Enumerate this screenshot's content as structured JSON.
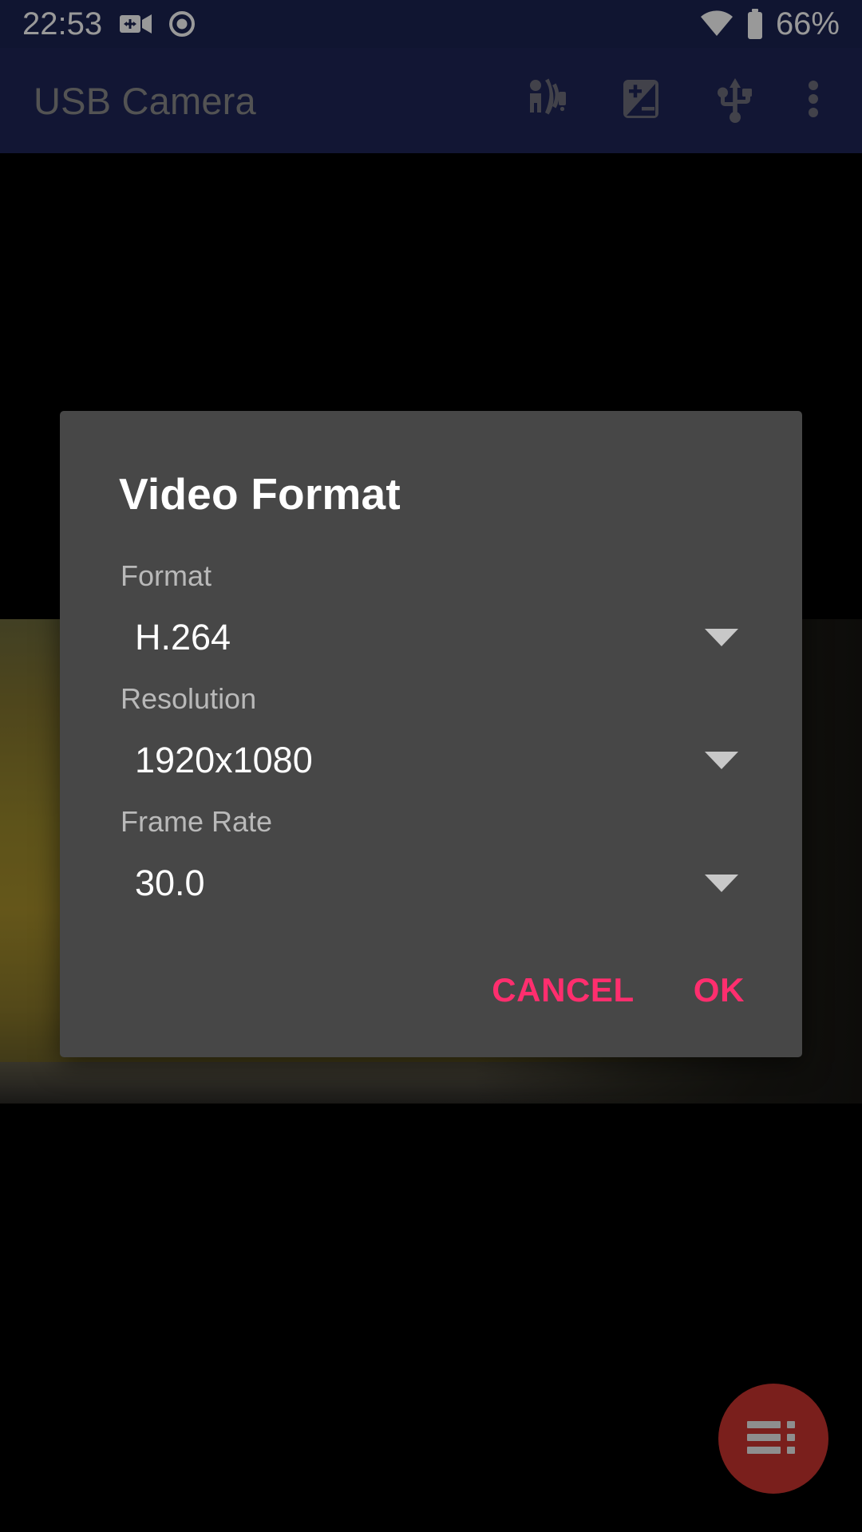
{
  "status_bar": {
    "clock": "22:53",
    "battery_text": "66%",
    "icons": {
      "usb_camera": "usb-video-camera-icon",
      "screen_record": "screen-record-icon",
      "wifi": "wifi-icon",
      "battery": "battery-icon"
    },
    "background_color": "#1b2352",
    "foreground_color": "#ffffff"
  },
  "app_bar": {
    "title": "USB Camera",
    "background_color": "#1e2657",
    "title_color": "#8a8a8a",
    "icon_color": "#6f6f7c",
    "actions": [
      {
        "name": "cast-icon",
        "label": "Cast"
      },
      {
        "name": "exposure-icon",
        "label": "Exposure"
      },
      {
        "name": "usb-icon",
        "label": "USB"
      },
      {
        "name": "overflow-menu-icon",
        "label": "More options"
      }
    ]
  },
  "dialog": {
    "title": "Video Format",
    "background_color": "#474747",
    "accent_color": "#ff2e6e",
    "fields": [
      {
        "label": "Format",
        "value": "H.264",
        "caret": "chevron-down-icon"
      },
      {
        "label": "Resolution",
        "value": "1920x1080",
        "caret": "chevron-down-icon"
      },
      {
        "label": "Frame Rate",
        "value": "30.0",
        "caret": "chevron-down-icon"
      }
    ],
    "buttons": {
      "cancel": "CANCEL",
      "ok": "OK"
    }
  },
  "fab": {
    "name": "menu-list-icon",
    "background_color": "#7a1f1c",
    "icon_color": "#8e8e8e"
  }
}
